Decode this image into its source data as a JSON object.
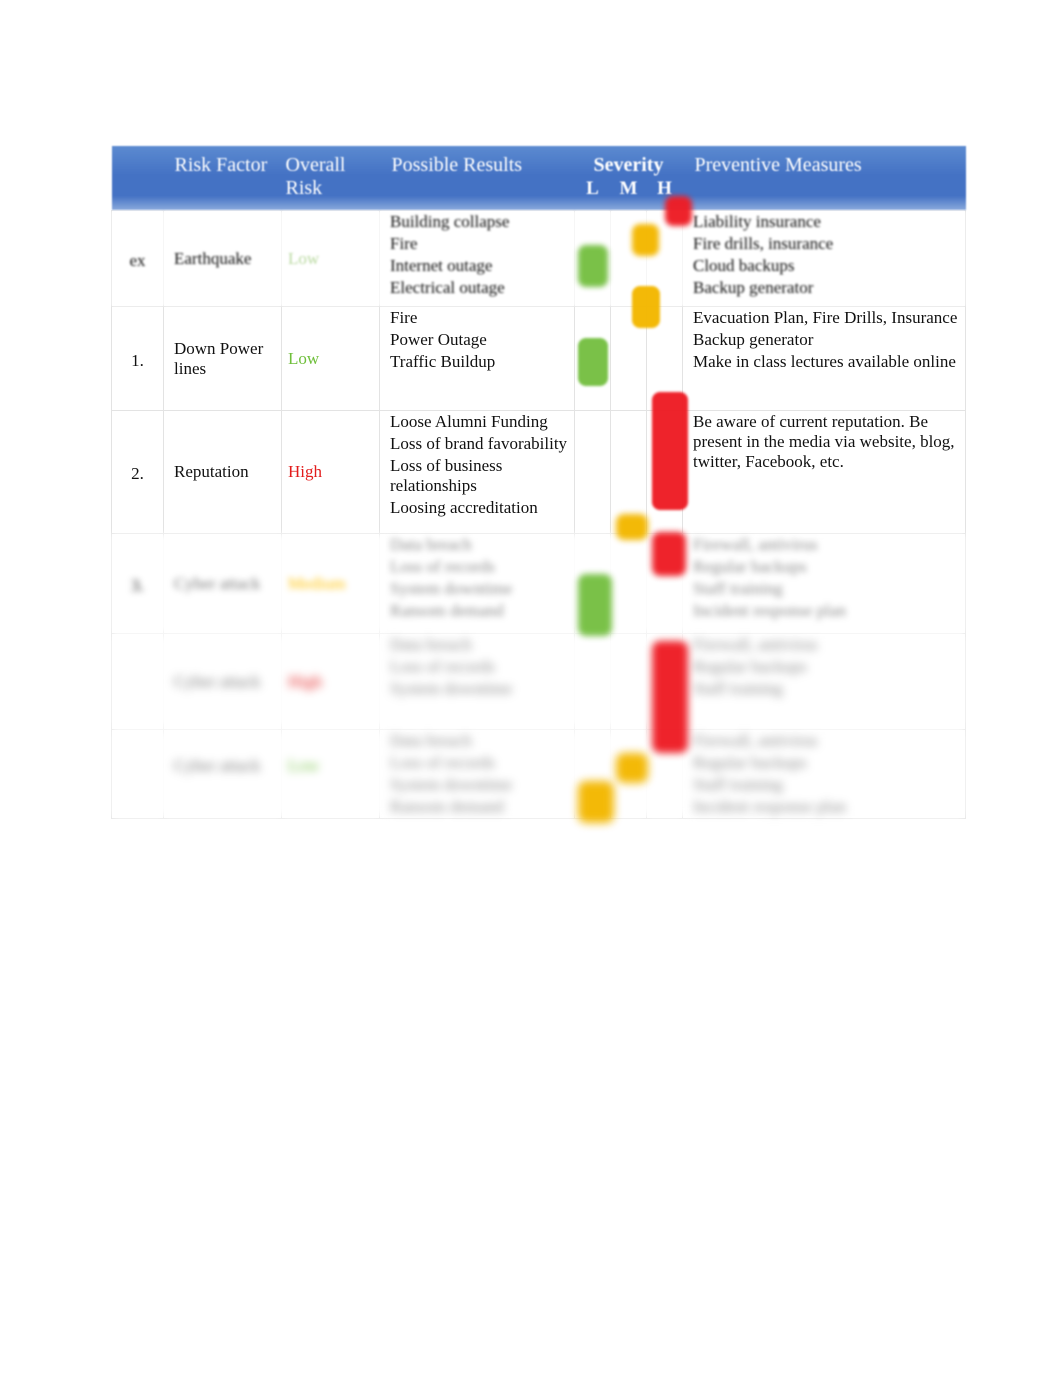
{
  "document": {
    "kind": "risk-assessment-table"
  },
  "table": {
    "headers": {
      "number": "",
      "risk_factor": "Risk Factor",
      "overall_risk_line1": "Overall",
      "overall_risk_line2": "Risk",
      "possible_results": "Possible Results",
      "severity": "Severity",
      "severity_low": "L",
      "severity_medium": "M",
      "severity_high": "H",
      "preventive_measures": "Preventive Measures"
    },
    "colors": {
      "header_blue": "#4472c4",
      "low_green": "#6fbf3b",
      "high_red": "#e21b1b",
      "medium_yellow": "#ffc000",
      "marker_green": "#76c043",
      "marker_yellow": "#f3b700",
      "marker_red": "#ee1c25"
    },
    "rows": [
      {
        "number": "ex",
        "risk_factor": "Earthquake",
        "overall_risk": "Low",
        "overall_risk_level": "low",
        "faded": true,
        "results": [
          "Building collapse",
          "Fire",
          "Internet outage",
          "Electrical outage"
        ],
        "preventive": [
          "Liability insurance",
          "Fire drills, insurance",
          "Cloud backups",
          "Backup generator"
        ],
        "severity": [
          "H",
          "M",
          "L",
          "L"
        ]
      },
      {
        "number": "1.",
        "risk_factor": "Down Power lines",
        "overall_risk": "Low",
        "overall_risk_level": "low",
        "faded": false,
        "results": [
          "Fire",
          "Power Outage",
          "Traffic Buildup"
        ],
        "preventive": [
          "Evacuation Plan, Fire Drills, Insurance",
          "Backup generator",
          "Make in class lectures available online"
        ],
        "severity": [
          "M",
          "L",
          "L"
        ]
      },
      {
        "number": "2.",
        "risk_factor": "Reputation",
        "overall_risk": "High",
        "overall_risk_level": "high",
        "faded": false,
        "results": [
          "Loose Alumni Funding",
          "Loss of brand favorability",
          "Loss of business relationships",
          "Loosing accreditation"
        ],
        "preventive": [
          "Be aware of current reputation. Be present in the media via website, blog, twitter, Facebook, etc."
        ],
        "severity": [
          "H",
          "H",
          "H",
          "H"
        ]
      },
      {
        "number": "3.",
        "risk_factor": "",
        "overall_risk": "",
        "overall_risk_level": "medium",
        "faded": false,
        "blurred": true,
        "results": [
          "",
          "",
          "",
          ""
        ],
        "preventive": [
          "",
          "",
          "",
          ""
        ],
        "severity": [
          "M",
          "H",
          "L",
          "H"
        ]
      },
      {
        "number": "",
        "risk_factor": "",
        "overall_risk": "",
        "overall_risk_level": "high",
        "faded": false,
        "blurred": true,
        "results": [
          "",
          "",
          ""
        ],
        "preventive": [
          "",
          "",
          ""
        ],
        "severity": [
          "H",
          "H",
          "H"
        ]
      },
      {
        "number": "",
        "risk_factor": "",
        "overall_risk": "",
        "overall_risk_level": "low",
        "faded": false,
        "blurred": true,
        "results": [
          "",
          "",
          "",
          ""
        ],
        "preventive": [
          "",
          "",
          "",
          ""
        ],
        "severity": [
          "H",
          "M",
          "M"
        ]
      }
    ]
  }
}
